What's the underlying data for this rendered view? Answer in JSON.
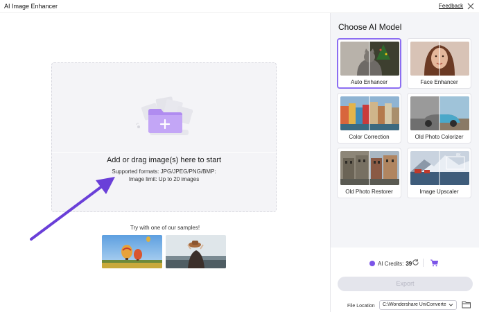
{
  "window": {
    "title": "AI Image Enhancer",
    "feedback_label": "Feedback"
  },
  "dropzone": {
    "main_text": "Add or drag image(s) here to start",
    "formats": "Supported formats: JPG/JPEG/PNG/BMP:",
    "limit": "Image limit: Up to 20 images"
  },
  "samples": {
    "label": "Try with one of our samples!"
  },
  "sidebar": {
    "title": "Choose AI Model",
    "models": [
      {
        "label": "Auto Enhancer",
        "selected": true
      },
      {
        "label": "Face Enhancer",
        "selected": false
      },
      {
        "label": "Color Correction",
        "selected": false
      },
      {
        "label": "Old Photo Colorizer",
        "selected": false
      },
      {
        "label": "Old Photo Restorer",
        "selected": false
      },
      {
        "label": "Image Upscaler",
        "selected": false
      }
    ],
    "credits_label": "AI Credits:",
    "credits_value": "39",
    "export_label": "Export",
    "file_location_label": "File Location",
    "file_location_value": "C:\\Wondershare UniConverte"
  },
  "colors": {
    "accent": "#8c6ef2",
    "arrow": "#6a3fd8",
    "folder": "#b08cf0"
  }
}
